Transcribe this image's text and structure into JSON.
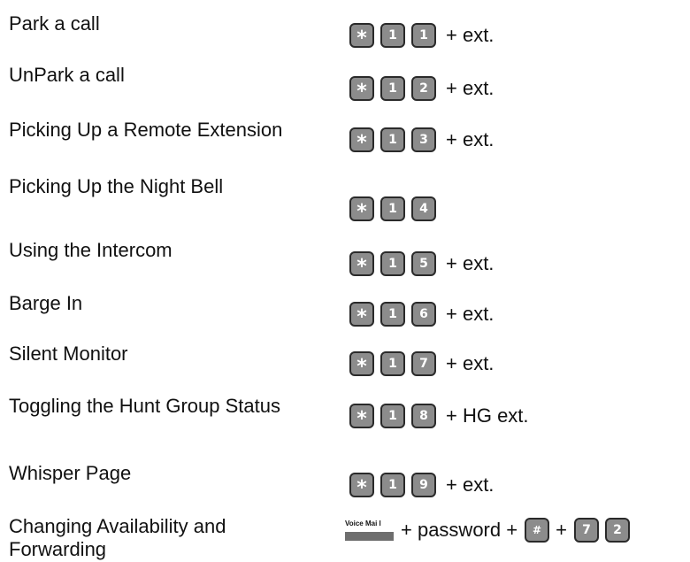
{
  "rows": [
    {
      "label": "Park a call",
      "keys": [
        "*",
        "1",
        "1"
      ],
      "suffix": "+ ext."
    },
    {
      "label": "UnPark a call",
      "keys": [
        "*",
        "1",
        "2"
      ],
      "suffix": "+ ext."
    },
    {
      "label": "Picking Up a Remote Extension",
      "keys": [
        "*",
        "1",
        "3"
      ],
      "suffix": "+ ext."
    },
    {
      "label": "Picking Up the Night Bell",
      "keys": [
        "*",
        "1",
        "4"
      ],
      "suffix": ""
    },
    {
      "label": "Using the Intercom",
      "keys": [
        "*",
        "1",
        "5"
      ],
      "suffix": "+ ext."
    },
    {
      "label": "Barge In",
      "keys": [
        "*",
        "1",
        "6"
      ],
      "suffix": "+ ext."
    },
    {
      "label": "Silent Monitor",
      "keys": [
        "*",
        "1",
        "7"
      ],
      "suffix": "+ ext."
    },
    {
      "label": "Toggling the Hunt Group Status",
      "keys": [
        "*",
        "1",
        "8"
      ],
      "suffix": "+ HG ext."
    },
    {
      "label": "Whisper Page",
      "keys": [
        "*",
        "1",
        "9"
      ],
      "suffix": "+ ext."
    }
  ],
  "last_row": {
    "label": "Changing Availability and Forwarding",
    "voicemail_key": "Voice Mai  l",
    "plus1": "+ password +",
    "hash": "#",
    "plus2": "+",
    "keys": [
      "7",
      "2"
    ]
  }
}
